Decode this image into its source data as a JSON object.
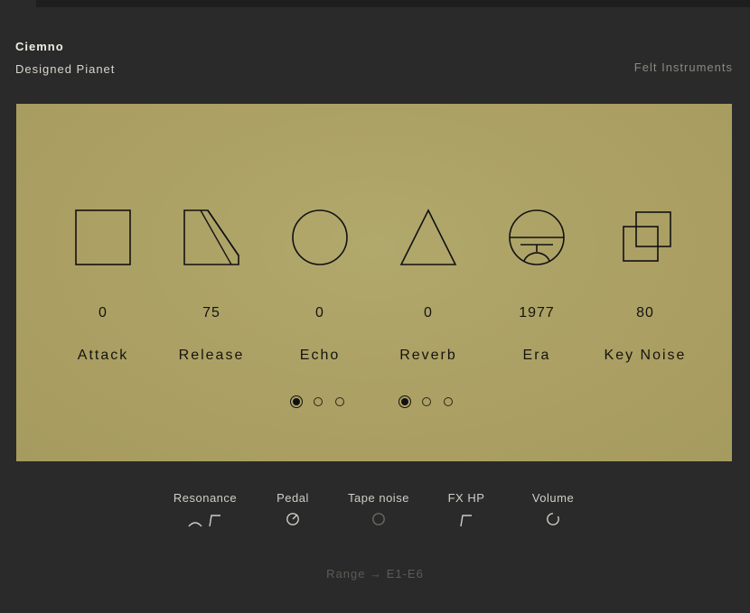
{
  "app": {
    "name": "Ciemno",
    "subtitle": "Designed Pianet",
    "maker": "Felt Instruments"
  },
  "controls": [
    {
      "icon": "square-icon",
      "value": "0",
      "label": "Attack"
    },
    {
      "icon": "trapezoid-icon",
      "value": "75",
      "label": "Release"
    },
    {
      "icon": "circle-icon",
      "value": "0",
      "label": "Echo"
    },
    {
      "icon": "triangle-icon",
      "value": "0",
      "label": "Reverb"
    },
    {
      "icon": "era-icon",
      "value": "1977",
      "label": "Era"
    },
    {
      "icon": "overlapping-squares-icon",
      "value": "80",
      "label": "Key Noise"
    }
  ],
  "echo_modes": {
    "selected": 1,
    "count": 3
  },
  "reverb_modes": {
    "selected": 1,
    "count": 3
  },
  "bottom": [
    {
      "label": "Resonance",
      "icon": "resonance-icon"
    },
    {
      "label": "Pedal",
      "icon": "pedal-toggle-icon"
    },
    {
      "label": "Tape noise",
      "icon": "tape-noise-toggle-icon"
    },
    {
      "label": "FX HP",
      "icon": "highpass-icon"
    },
    {
      "label": "Volume",
      "icon": "volume-knob-icon"
    }
  ],
  "range": "Range → E1-E6",
  "colors": {
    "panel": "#ada367",
    "background": "#2a2a2a",
    "ink": "#15140f"
  }
}
